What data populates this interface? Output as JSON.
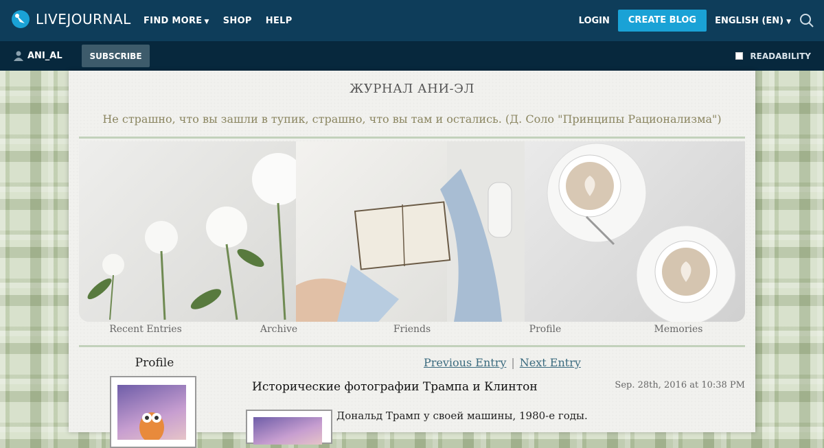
{
  "header": {
    "logo_text": "LIVEJOURNAL",
    "nav": [
      {
        "label": "FIND MORE",
        "has_caret": true
      },
      {
        "label": "SHOP",
        "has_caret": false
      },
      {
        "label": "HELP",
        "has_caret": false
      }
    ],
    "login": "LOGIN",
    "create_blog": "CREATE BLOG",
    "language": "ENGLISH (EN)",
    "colors": {
      "bar": "#0e3d5a",
      "accent": "#1aa2d6"
    }
  },
  "subbar": {
    "username": "ANI_AL",
    "subscribe": "SUBSCRIBE",
    "readability": "READABILITY"
  },
  "journal": {
    "title": "ЖУРНАЛ АНИ-ЭЛ",
    "subtitle": "Не страшно, что вы зашли в тупик, страшно, что вы там и остались. (Д. Соло \"Принципы Рационализма\")",
    "tabs": [
      "Recent Entries",
      "Archive",
      "Friends",
      "Profile",
      "Memories"
    ]
  },
  "sidebar": {
    "title": "Profile"
  },
  "pager": {
    "previous": "Previous Entry",
    "separator": "|",
    "next": "Next Entry"
  },
  "entry": {
    "title": "Исторические фотографии Трампа и Клинтон",
    "date": "Sep. 28th, 2016 at 10:38 PM",
    "text": "Дональд Трамп у своей машины, 1980-е годы."
  }
}
